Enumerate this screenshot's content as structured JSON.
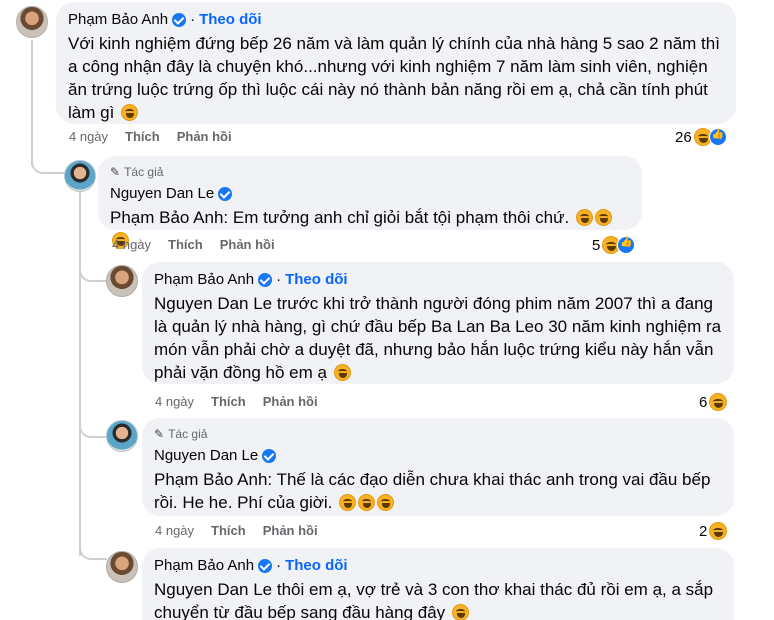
{
  "labels": {
    "author_badge": "Tác giả",
    "follow": "Theo dõi",
    "like": "Thích",
    "reply": "Phản hồi"
  },
  "comments": [
    {
      "author": "Phạm Bảo Anh",
      "follow": "Theo dõi",
      "text": "Với kinh nghiệm đứng bếp 26 năm và làm quản lý chính của nhà hàng 5 sao 2 năm thì a công nhận đây là chuyện khó...nhưng với kinh nghiệm 7 năm làm sinh viên, nghiện ăn trứng luộc trứng ốp thì luộc cái này nó thành bản năng rồi em ạ, chả cần tính phút làm gì",
      "time": "4 ngày",
      "reactions": "26"
    },
    {
      "author": "Nguyen Dan Le",
      "badge": "Tác giả",
      "mention": "Phạm Bảo Anh:",
      "text": "Em tưởng anh chỉ giỏi bắt tội phạm thôi chứ.",
      "time": "4 ngày",
      "reactions": "5"
    },
    {
      "author": "Phạm Bảo Anh",
      "follow": "Theo dõi",
      "mention": "Nguyen Dan Le",
      "text": "trước khi trở thành người đóng phim năm 2007 thì a đang là quản lý nhà hàng, gì chứ đầu bếp Ba Lan Ba Leo 30 năm kinh nghiệm ra món vẫn phải chờ a duyệt đã, nhưng bảo hắn luộc trứng kiểu này hắn vẫn phải vặn đồng hồ em ạ",
      "time": "4 ngày",
      "reactions": "6"
    },
    {
      "author": "Nguyen Dan Le",
      "badge": "Tác giả",
      "mention": "Phạm Bảo Anh:",
      "text": "Thế là các đạo diễn chưa khai thác anh trong vai đầu bếp rồi. He he. Phí của giời.",
      "time": "4 ngày",
      "reactions": "2"
    },
    {
      "author": "Phạm Bảo Anh",
      "follow": "Theo dõi",
      "mention": "Nguyen Dan Le",
      "text": "thôi em ạ, vợ trẻ và 3 con thơ khai thác đủ rồi em ạ, a sắp chuyển từ đầu bếp sang đầu hàng đây"
    }
  ]
}
